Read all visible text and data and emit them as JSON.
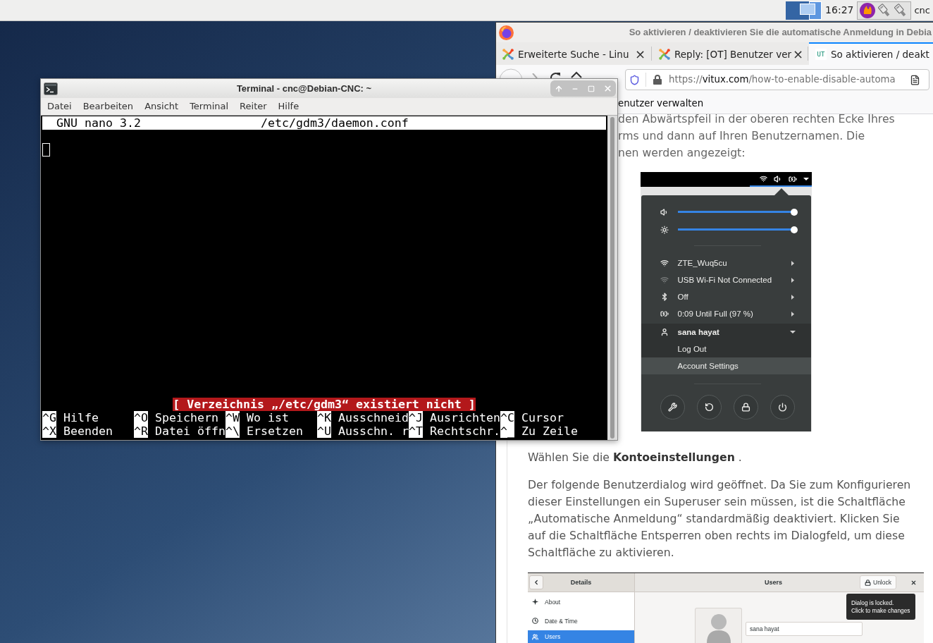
{
  "top_panel": {
    "clock": "16:27",
    "user": "cnc"
  },
  "browser": {
    "title": "So aktivieren / deaktivieren Sie die automatische Anmeldung in Debia",
    "tabs": [
      {
        "kind": "pinwheel",
        "label": "Erweiterte Suche - Linu",
        "selected": false,
        "close": "×"
      },
      {
        "kind": "pinwheel",
        "label": "Reply: [OT] Benutzer ver",
        "selected": false,
        "close": "×"
      },
      {
        "kind": "letters",
        "favicon_text": "UT",
        "label": "So aktivieren / deakt",
        "selected": true
      }
    ],
    "address": {
      "scheme": "https://",
      "domain": "vitux.com",
      "path": "/how-to-enable-disable-automa"
    },
    "bookmarks_bar": [
      "enutzer verwalten"
    ],
    "article": {
      "intro_lines": [
        "den Abwärtspfeil in der oberen rechten Ecke Ihres",
        "rms und dann auf Ihren Benutzernamen. Die",
        "nen werden angezeigt:"
      ],
      "system_menu_screenshot": {
        "sliders": [
          {
            "kind": "volume",
            "level": 1
          },
          {
            "kind": "brightness",
            "level": 1
          }
        ],
        "items": [
          {
            "kind": "wifi",
            "label": "ZTE_Wuq5cu",
            "dimmed": false
          },
          {
            "kind": "wifi",
            "label": "USB Wi-Fi Not Connected",
            "dimmed": true
          },
          {
            "kind": "bluetooth",
            "label": "Off",
            "dimmed": false
          },
          {
            "kind": "battery",
            "label": "0:09 Until Full (97 %)",
            "dimmed": false
          }
        ],
        "user": {
          "name": "sana hayat",
          "expanded": true
        },
        "submenu": [
          {
            "label": "Log Out",
            "selected": false
          },
          {
            "label": "Account Settings",
            "selected": true
          }
        ],
        "buttons": [
          {
            "kind": "tools"
          },
          {
            "kind": "rotation"
          },
          {
            "kind": "lock"
          },
          {
            "kind": "power"
          }
        ]
      },
      "instruction": "Wählen Sie die **Kontoeinstellungen** .",
      "paragraph": "Der folgende Benutzerdialog wird geöffnet. Da Sie zum Konfigurieren dieser Einstellungen ein Superuser sein müssen, ist die Schaltfläche „Automatische Anmeldung“ standardmäßig deaktiviert. Klicken Sie auf die Schaltfläche Entsperren oben rechts im Dialogfeld, um diese Schaltfläche zu aktivieren.",
      "users_dialog_screenshot": {
        "sidebar_title": "Details",
        "title": "Users",
        "unlock_button": "Unlock",
        "sidebar": [
          {
            "kind": "about",
            "label": "About",
            "selected": false
          },
          {
            "kind": "clock",
            "label": "Date & Time",
            "selected": false
          },
          {
            "kind": "users",
            "label": "Users",
            "selected": true
          }
        ],
        "name_field": {
          "value": "sana hayat"
        },
        "tooltip": [
          "Dialog is locked.",
          "Click to make changes"
        ]
      }
    }
  },
  "terminal": {
    "title": "Terminal - cnc@Debian-CNC: ~",
    "menu": [
      "Datei",
      "Bearbeiten",
      "Ansicht",
      "Terminal",
      "Reiter",
      "Hilfe"
    ],
    "nano": {
      "version": "GNU nano 3.2",
      "filename": "/etc/gdm3/daemon.conf",
      "status": "[ Verzeichnis „/etc/gdm3“ existiert nicht ]",
      "shortcuts": [
        [
          {
            "key": "^G",
            "label": "Hilfe"
          },
          {
            "key": "^O",
            "label": "Speichern"
          },
          {
            "key": "^W",
            "label": "Wo ist"
          },
          {
            "key": "^K",
            "label": "Ausschneid"
          },
          {
            "key": "^J",
            "label": "Ausrichten"
          },
          {
            "key": "^C",
            "label": "Cursor"
          }
        ],
        [
          {
            "key": "^X",
            "label": "Beenden"
          },
          {
            "key": "^R",
            "label": "Datei öffn"
          },
          {
            "key": "^\\",
            "label": "Ersetzen"
          },
          {
            "key": "^U",
            "label": "Ausschn. r"
          },
          {
            "key": "^T",
            "label": "Rechtschr."
          },
          {
            "key": "^_",
            "label": "Zu Zeile"
          }
        ]
      ]
    }
  }
}
